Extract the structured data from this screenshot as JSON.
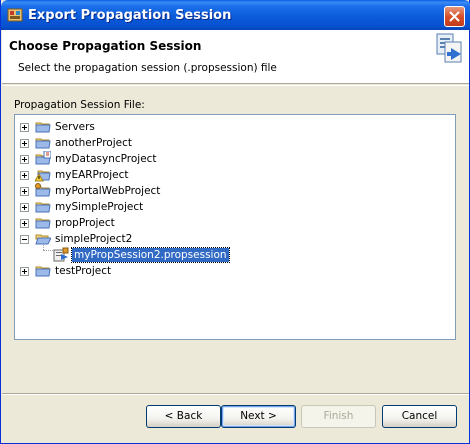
{
  "window": {
    "title": "Export Propagation Session"
  },
  "banner": {
    "title": "Choose Propagation Session",
    "description": "Select the propagation session (.propsession) file"
  },
  "section_label": "Propagation Session File:",
  "tree": {
    "items": [
      {
        "label": "Servers",
        "icon": "folder-icon",
        "expander": "plus"
      },
      {
        "label": "anotherProject",
        "icon": "folder-icon",
        "expander": "plus"
      },
      {
        "label": "myDatasyncProject",
        "icon": "datasync-project-icon",
        "expander": "plus"
      },
      {
        "label": "myEARProject",
        "icon": "ear-project-icon",
        "expander": "plus"
      },
      {
        "label": "myPortalWebProject",
        "icon": "portal-web-project-icon",
        "expander": "plus"
      },
      {
        "label": "mySimpleProject",
        "icon": "folder-icon",
        "expander": "plus"
      },
      {
        "label": "propProject",
        "icon": "folder-icon",
        "expander": "plus"
      },
      {
        "label": "simpleProject2",
        "icon": "folder-open-icon",
        "expander": "minus"
      },
      {
        "label": "myPropSession2.propsession",
        "icon": "propsession-file-icon",
        "expander": "none",
        "selected": true
      },
      {
        "label": "testProject",
        "icon": "folder-icon",
        "expander": "plus"
      }
    ]
  },
  "buttons": {
    "back": "< Back",
    "next": "Next >",
    "finish": "Finish",
    "cancel": "Cancel"
  },
  "colors": {
    "titlebar": "#0A5AD9",
    "selection": "#316AC5",
    "dialog_bg": "#ECE9D8"
  }
}
